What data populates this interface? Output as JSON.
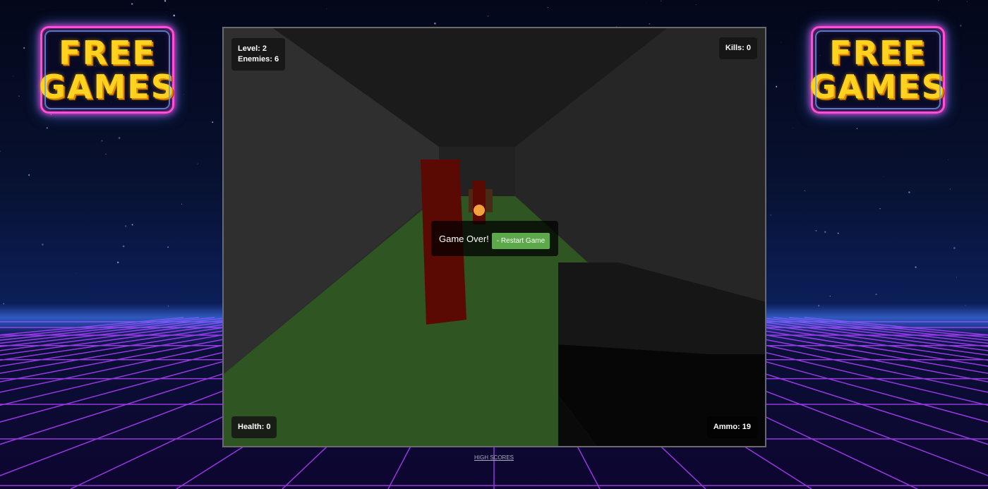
{
  "logos": {
    "left": {
      "line1": "FREE",
      "line2": "GAMES"
    },
    "right": {
      "line1": "FREE",
      "line2": "GAMES"
    }
  },
  "hud": {
    "level_label": "Level: 2",
    "enemies_label": "Enemies: 6",
    "kills_label": "Kills: 0",
    "health_label": "Health: 0",
    "ammo_label": "Ammo: 19"
  },
  "game_over": {
    "message": "Game Over!",
    "restart_button": "- Restart Game"
  },
  "footer": {
    "high_scores_link": "HIGH SCORES"
  },
  "colors": {
    "floor": "#2e5522",
    "enemy": "#5a0a02",
    "projectile": "#f2a23a",
    "restart_button": "#5ca84a",
    "logo_text": "#ffd21f",
    "logo_border": "#ff4fd8"
  }
}
